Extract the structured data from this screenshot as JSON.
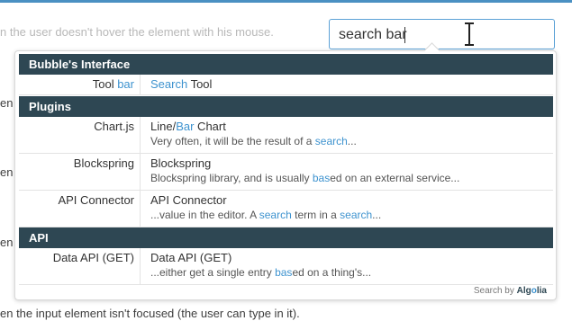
{
  "background": {
    "line1": "n the user doesn't hover the element with his mouse.",
    "line2": "en t",
    "line3": "en t",
    "line4": "en t",
    "line5": "en the input element isn't focused (the user can type in it)."
  },
  "search": {
    "value": "search bar"
  },
  "colors": {
    "header_bg": "#2e4753",
    "highlight": "#3e93cf",
    "input_border": "#5ba1d6"
  },
  "dropdown": {
    "sections": [
      {
        "header": "Bubble's Interface",
        "rows": [
          {
            "left_pre": "Tool ",
            "left_hl": "bar",
            "left_post": "",
            "right_hl": "Search",
            "right_post": " Tool"
          }
        ]
      },
      {
        "header": "Plugins",
        "rows": [
          {
            "left": "Chart.js",
            "title_pre": "Line/",
            "title_hl": "Bar",
            "title_post": " Chart",
            "snippet_pre": "Very often, it will be the result of a ",
            "snippet_hl": "search",
            "snippet_post": "..."
          },
          {
            "left": "Blockspring",
            "title": "Blockspring",
            "snippet_pre": "Blockspring library, and is usually ",
            "snippet_hl": "bas",
            "snippet_post": "ed on an external service..."
          },
          {
            "left": "API Connector",
            "title": "API Connector",
            "snippet_pre": "...value in the editor. A ",
            "snippet_hl": "search",
            "snippet_mid": " term in a ",
            "snippet_hl2": "search",
            "snippet_post": "..."
          }
        ]
      },
      {
        "header": "API",
        "rows": [
          {
            "left": "Data API (GET)",
            "title": "Data API (GET)",
            "snippet_pre": "...either get a single entry ",
            "snippet_hl": "bas",
            "snippet_post": "ed on a thing's..."
          }
        ]
      }
    ],
    "footer": {
      "prefix": "Search by ",
      "brand_a": "Alg",
      "brand_o": "o",
      "brand_b": "lia"
    }
  }
}
